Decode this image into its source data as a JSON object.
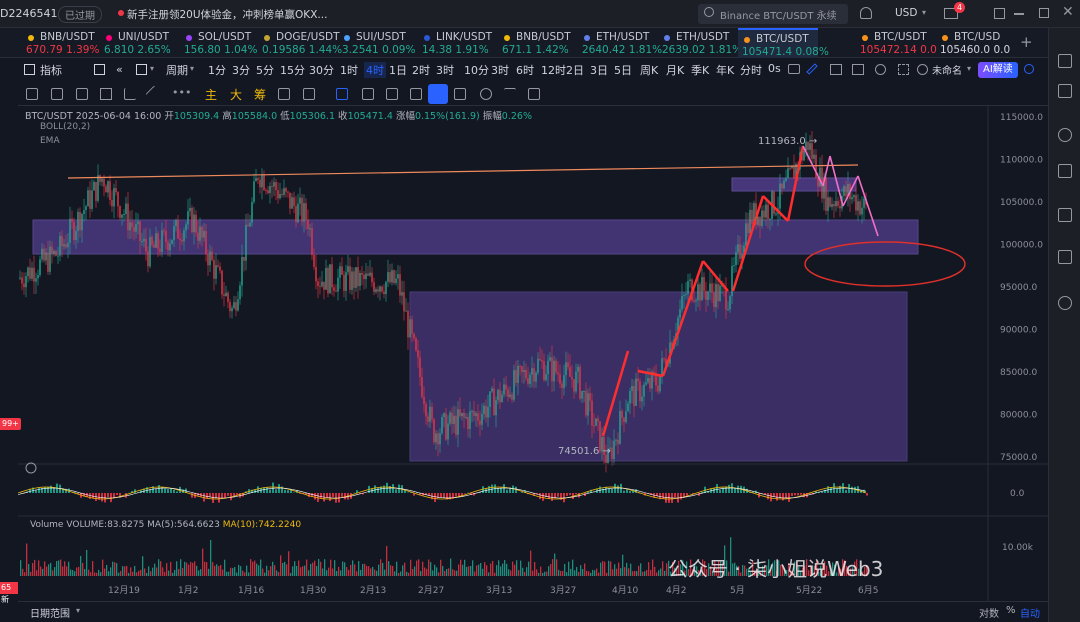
{
  "header": {
    "account_id": "D2246541",
    "badge": "已过期",
    "notice": "新手注册领20U体验金，冲刺榜单赢OKX...",
    "search_placeholder": "Binance BTC/USDT 永续",
    "currency": "USD",
    "mail_count": "4"
  },
  "tickers": [
    {
      "symbol": "BNB/USDT",
      "price": "670.79",
      "change": "1.39%",
      "color": "#f23645",
      "dot": "#f0b90b"
    },
    {
      "symbol": "UNI/USDT",
      "price": "6.810",
      "change": "2.65%",
      "color": "#22ab94",
      "dot": "#ff007a"
    },
    {
      "symbol": "SOL/USDT",
      "price": "156.80",
      "change": "1.04%",
      "color": "#22ab94",
      "dot": "#9945ff"
    },
    {
      "symbol": "DOGE/USDT",
      "price": "0.19586",
      "change": "1.44%",
      "color": "#22ab94",
      "dot": "#c2a633"
    },
    {
      "symbol": "SUI/USDT",
      "price": "3.2541",
      "change": "0.09%",
      "color": "#22ab94",
      "dot": "#4da2ff"
    },
    {
      "symbol": "LINK/USDT",
      "price": "14.38",
      "change": "1.91%",
      "color": "#22ab94",
      "dot": "#2a5ada"
    },
    {
      "symbol": "BNB/USDT",
      "price": "671.1",
      "change": "1.42%",
      "color": "#22ab94",
      "dot": "#f0b90b"
    },
    {
      "symbol": "ETH/USDT",
      "price": "2640.42",
      "change": "1.81%",
      "color": "#22ab94",
      "dot": "#627eea"
    },
    {
      "symbol": "ETH/USDT",
      "price": "2639.02",
      "change": "1.81%",
      "color": "#22ab94",
      "dot": "#627eea"
    },
    {
      "symbol": "BTC/USDT",
      "price": "105471.4",
      "change": "0.08%",
      "color": "#22ab94",
      "dot": "#f7931a"
    },
    {
      "symbol": "BTC/USDT",
      "price": "105472.14",
      "change": "0.0",
      "color": "#f23645",
      "dot": "#f7931a"
    },
    {
      "symbol": "BTC/USD",
      "price": "105460.0",
      "change": "0.0",
      "color": "#d1d4dc",
      "dot": "#f7931a"
    }
  ],
  "toolbar": {
    "indicators": "指标",
    "period": "周期",
    "intervals": [
      "1分",
      "3分",
      "5分",
      "15分",
      "30分",
      "1时",
      "4时",
      "1日",
      "2时",
      "3时",
      "10分",
      "3时",
      "6时",
      "12时",
      "2日",
      "3日",
      "5日",
      "周K",
      "月K",
      "季K",
      "年K",
      "分时"
    ],
    "active_interval": "4时",
    "countdown": "0s",
    "layout_name": "未命名",
    "ai_button": "AI解读"
  },
  "drawtools": {
    "main": "主",
    "big": "大",
    "chip": "筹"
  },
  "ohlc": {
    "symbol": "BTC/USDT",
    "datetime": "2025-06-04 16:00",
    "open_label": "开",
    "open": "105309.4",
    "high_label": "高",
    "high": "105584.0",
    "low_label": "低",
    "low": "105306.1",
    "close_label": "收",
    "close": "105471.4",
    "change_label": "涨幅",
    "change": "0.15%(161.9)",
    "amplitude_label": "振幅",
    "amplitude": "0.26%"
  },
  "indicators": {
    "boll": "BOLL(20,2)",
    "ema": "EMA"
  },
  "volume": {
    "label": "Volume",
    "vol": "VOLUME:83.8275",
    "ma5": "MA(5):564.6623",
    "ma10": "MA(10):742.2240",
    "ma10_color": "#f0b90b",
    "axis": "10.00k"
  },
  "annotations": {
    "high": "111963.0",
    "low": "74501.6"
  },
  "price_axis": [
    "115000.0",
    "110000.0",
    "105000.0",
    "100000.0",
    "95000.0",
    "90000.0",
    "85000.0",
    "80000.0",
    "75000.0"
  ],
  "macd_axis": "0.0",
  "time_axis": [
    "12月19",
    "1月2",
    "1月16",
    "1月30",
    "2月13",
    "2月27",
    "3月13",
    "3月27",
    "4月10",
    "4月2",
    "5月",
    "5月22",
    "6月5"
  ],
  "left_tags": {
    "tag1": "99+",
    "tag2": "65新"
  },
  "watermark": "公众号 · 柒小姐说Web3",
  "bottom": {
    "date_range": "日期范围",
    "log": "对数",
    "percent": "%",
    "auto": "自动"
  },
  "colors": {
    "up": "#22ab94",
    "down": "#f23645",
    "zone": "#6a4bb5",
    "arrow": "#ff2e2e",
    "pink": "#f070c8"
  }
}
